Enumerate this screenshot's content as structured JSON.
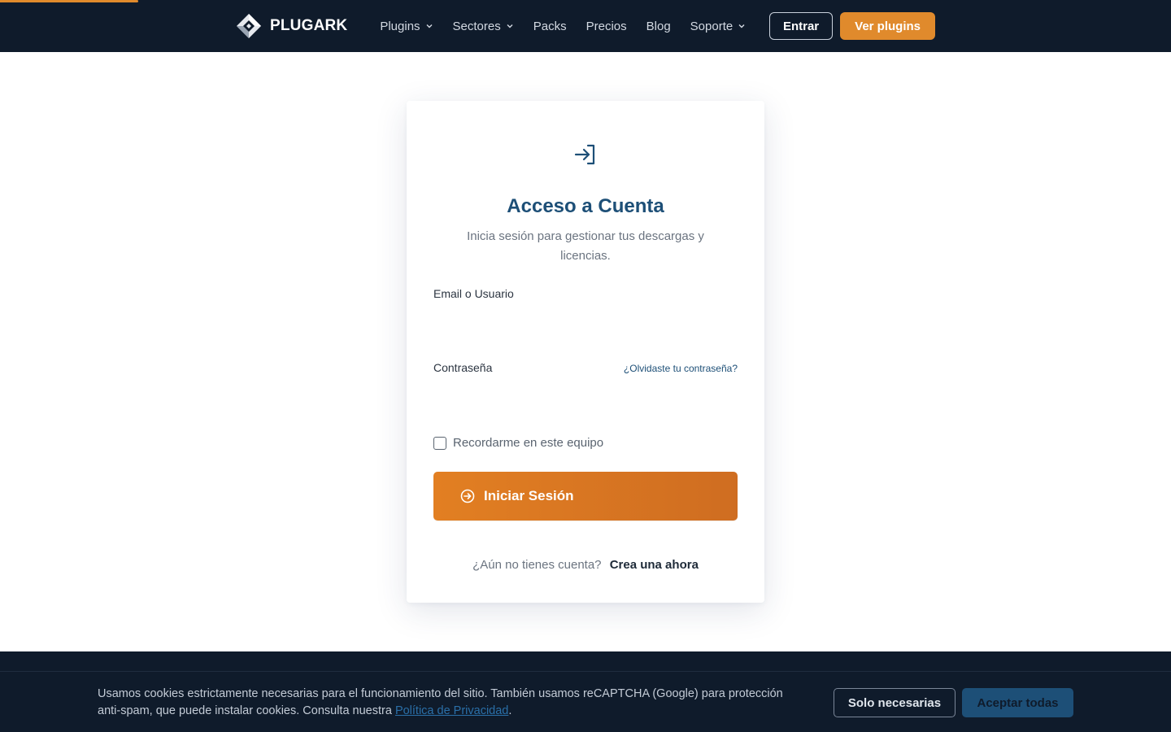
{
  "header": {
    "brand": "PLUGARK",
    "nav": [
      {
        "label": "Plugins",
        "has_dropdown": true
      },
      {
        "label": "Sectores",
        "has_dropdown": true
      },
      {
        "label": "Packs",
        "has_dropdown": false
      },
      {
        "label": "Precios",
        "has_dropdown": false
      },
      {
        "label": "Blog",
        "has_dropdown": false
      },
      {
        "label": "Soporte",
        "has_dropdown": true
      }
    ],
    "login_label": "Entrar",
    "cta_label": "Ver plugins"
  },
  "login": {
    "icon": "login-arrow-icon",
    "title": "Acceso a Cuenta",
    "subtitle": "Inicia sesión para gestionar tus descargas y licencias.",
    "email_label": "Email o Usuario",
    "email_value": "",
    "password_label": "Contraseña",
    "password_value": "",
    "forgot_label": "¿Olvidaste tu contraseña?",
    "remember_label": "Recordarme en este equipo",
    "remember_checked": false,
    "submit_label": "Iniciar Sesión",
    "signup_question": "¿Aún no tienes cuenta?",
    "signup_link": "Crea una ahora"
  },
  "cookie": {
    "text": "Usamos cookies estrictamente necesarias para el funcionamiento del sitio. También usamos reCAPTCHA (Google) para protección anti-spam, que puede instalar cookies. Consulta nuestra",
    "link": "Política de Privacidad",
    "text_end": ".",
    "reject_label": "Solo necesarias",
    "accept_label": "Aceptar todas"
  },
  "colors": {
    "header_bg": "#0f1b2b",
    "accent_orange": "#e08a2c",
    "title_blue": "#1d4f77"
  }
}
